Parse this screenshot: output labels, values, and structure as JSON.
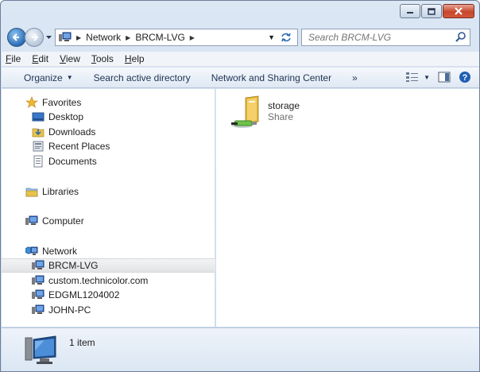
{
  "window": {
    "caption_buttons": [
      "minimize",
      "maximize",
      "close"
    ]
  },
  "address": {
    "crumbs": [
      "Network",
      "BRCM-LVG"
    ],
    "search_placeholder": "Search BRCM-LVG"
  },
  "menu": {
    "items": [
      {
        "key": "F",
        "rest": "ile"
      },
      {
        "key": "E",
        "rest": "dit"
      },
      {
        "key": "V",
        "rest": "iew"
      },
      {
        "key": "T",
        "rest": "ools"
      },
      {
        "key": "H",
        "rest": "elp"
      }
    ]
  },
  "command_bar": {
    "organize": "Organize",
    "search_ad": "Search active directory",
    "network_sharing": "Network and Sharing Center",
    "more": "»"
  },
  "nav": {
    "favorites": "Favorites",
    "desktop": "Desktop",
    "downloads": "Downloads",
    "recent": "Recent Places",
    "documents": "Documents",
    "libraries": "Libraries",
    "computer": "Computer",
    "network": "Network",
    "net_items": [
      "BRCM-LVG",
      "custom.technicolor.com",
      "EDGML1204002",
      "JOHN-PC"
    ]
  },
  "content": {
    "item_name": "storage",
    "item_type": "Share"
  },
  "details": {
    "count": "1 item"
  },
  "colors": {
    "window_frame": "#c9d9ec",
    "accent_blue": "#2a6db5",
    "close_red": "#c7472c",
    "folder_yellow": "#e8c24a"
  }
}
